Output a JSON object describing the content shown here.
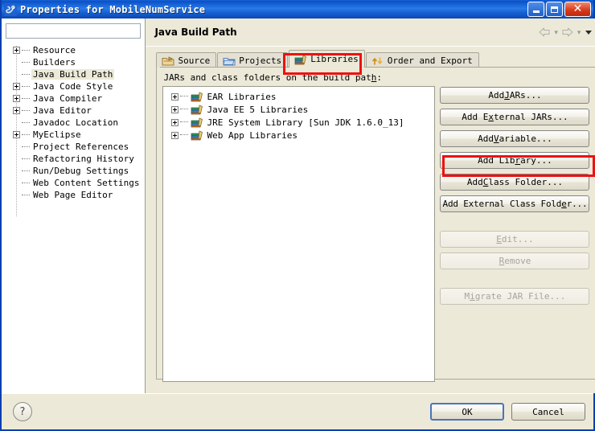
{
  "window": {
    "title": "Properties for MobileNumService",
    "icon": "properties-icon",
    "controls": {
      "minimize": "minimize-icon",
      "maximize": "maximize-icon",
      "close": "close-icon"
    }
  },
  "sidebar": {
    "filter": {
      "value": "",
      "placeholder": ""
    },
    "items": [
      {
        "label": "Resource",
        "expandable": true,
        "selected": false
      },
      {
        "label": "Builders",
        "expandable": false,
        "selected": false
      },
      {
        "label": "Java Build Path",
        "expandable": false,
        "selected": true
      },
      {
        "label": "Java Code Style",
        "expandable": true,
        "selected": false
      },
      {
        "label": "Java Compiler",
        "expandable": true,
        "selected": false
      },
      {
        "label": "Java Editor",
        "expandable": true,
        "selected": false
      },
      {
        "label": "Javadoc Location",
        "expandable": false,
        "selected": false
      },
      {
        "label": "MyEclipse",
        "expandable": true,
        "selected": false
      },
      {
        "label": "Project References",
        "expandable": false,
        "selected": false
      },
      {
        "label": "Refactoring History",
        "expandable": false,
        "selected": false
      },
      {
        "label": "Run/Debug Settings",
        "expandable": false,
        "selected": false
      },
      {
        "label": "Web Content Settings",
        "expandable": false,
        "selected": false
      },
      {
        "label": "Web Page Editor",
        "expandable": false,
        "selected": false
      }
    ]
  },
  "page": {
    "title": "Java Build Path",
    "nav": {
      "back": "back-arrow-icon",
      "forward": "forward-arrow-icon",
      "menu": "chevron-down-icon"
    }
  },
  "tabs": [
    {
      "label": "Source",
      "icon": "source-folder-icon",
      "active": false
    },
    {
      "label": "Projects",
      "icon": "projects-folder-icon",
      "active": false
    },
    {
      "label": "Libraries",
      "icon": "libraries-books-icon",
      "active": true
    },
    {
      "label": "Order and Export",
      "icon": "order-export-arrows-icon",
      "active": false
    }
  ],
  "libraries_panel": {
    "label_pre": "JARs and class folders on the build pat",
    "label_mnemonic": "h",
    "label_post": ":",
    "entries": [
      {
        "label": "EAR Libraries",
        "icon": "library-books-icon"
      },
      {
        "label": "Java EE 5 Libraries",
        "icon": "library-books-icon"
      },
      {
        "label": "JRE System Library [Sun JDK 1.6.0_13]",
        "icon": "library-books-icon"
      },
      {
        "label": "Web App Libraries",
        "icon": "library-books-icon"
      }
    ],
    "buttons": [
      {
        "pre": "Add ",
        "mnemonic": "J",
        "post": "ARs...",
        "disabled": false,
        "highlighted": false,
        "name": "add-jars-button"
      },
      {
        "pre": "Add E",
        "mnemonic": "x",
        "post": "ternal JARs...",
        "disabled": false,
        "highlighted": false,
        "name": "add-external-jars-button"
      },
      {
        "pre": "Add ",
        "mnemonic": "V",
        "post": "ariable...",
        "disabled": false,
        "highlighted": false,
        "name": "add-variable-button"
      },
      {
        "pre": "Add Lib",
        "mnemonic": "r",
        "post": "ary...",
        "disabled": false,
        "highlighted": true,
        "name": "add-library-button"
      },
      {
        "pre": "Add ",
        "mnemonic": "C",
        "post": "lass Folder...",
        "disabled": false,
        "highlighted": false,
        "name": "add-class-folder-button"
      },
      {
        "pre": "Add External Class Fold",
        "mnemonic": "e",
        "post": "r...",
        "disabled": false,
        "highlighted": false,
        "name": "add-external-class-folder-button"
      },
      {
        "pre": "",
        "mnemonic": "E",
        "post": "dit...",
        "disabled": true,
        "highlighted": false,
        "name": "edit-button"
      },
      {
        "pre": "",
        "mnemonic": "R",
        "post": "emove",
        "disabled": true,
        "highlighted": false,
        "name": "remove-button"
      },
      {
        "pre": "M",
        "mnemonic": "i",
        "post": "grate JAR File...",
        "disabled": true,
        "highlighted": false,
        "name": "migrate-jar-file-button"
      }
    ]
  },
  "footer": {
    "help": "?",
    "ok": "OK",
    "cancel": "Cancel"
  },
  "colors": {
    "accent_blue": "#0a51c8",
    "dialog_bg": "#ece9d8",
    "highlight_red": "#ee1111",
    "default_button_border": "#4a74bd"
  }
}
